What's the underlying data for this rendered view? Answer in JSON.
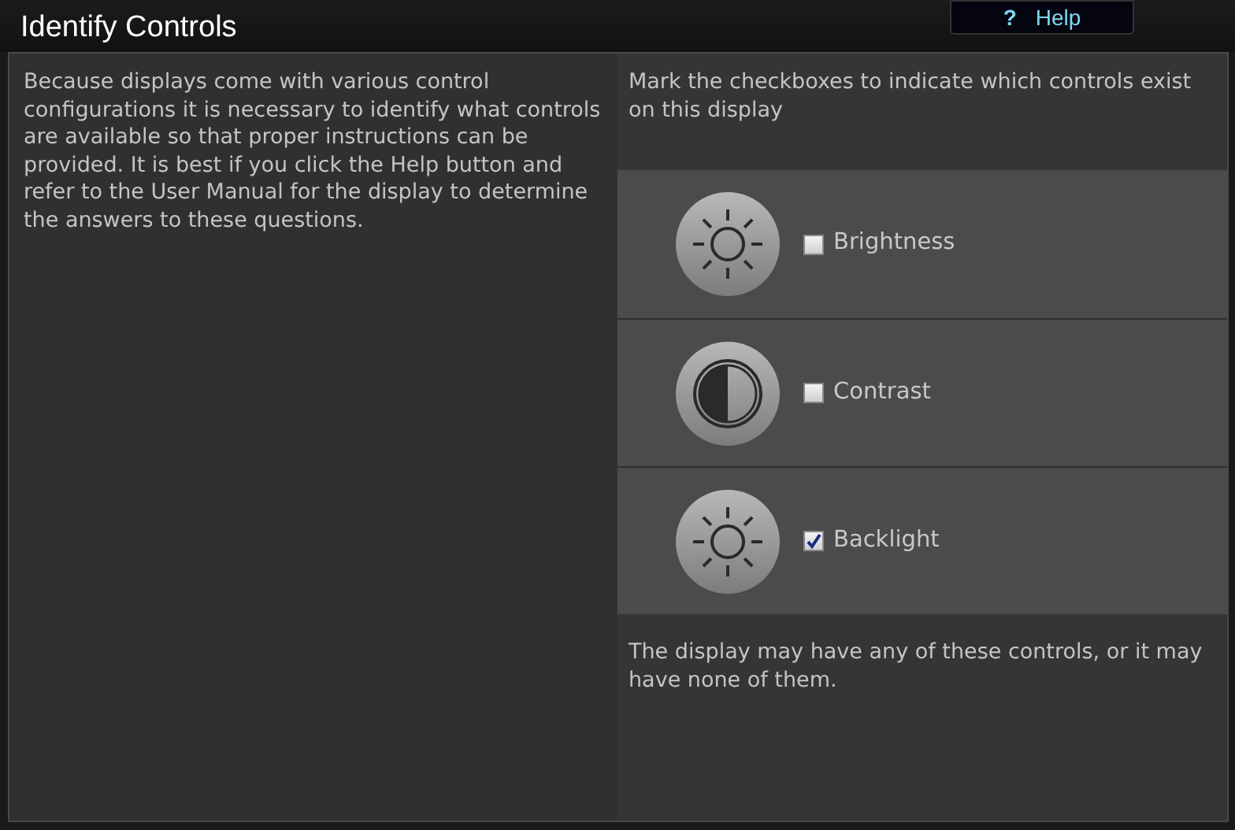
{
  "window": {
    "title": "Identify Controls"
  },
  "help_button": {
    "icon": "?",
    "label": "Help"
  },
  "intro": "Because displays come with various control configurations it is necessary to identify what controls are available so that proper instructions can be provided. It is best if you click the Help button and refer to the User Manual for the display to determine the answers to these questions.",
  "instruction": "Mark the checkboxes to indicate which controls exist on this display",
  "controls": [
    {
      "kind": "sun",
      "label": "Brightness",
      "checked": false
    },
    {
      "kind": "contrast",
      "label": "Contrast",
      "checked": false
    },
    {
      "kind": "sun",
      "label": "Backlight",
      "checked": true
    }
  ],
  "note": "The display may have any of these controls, or it may have none of them."
}
